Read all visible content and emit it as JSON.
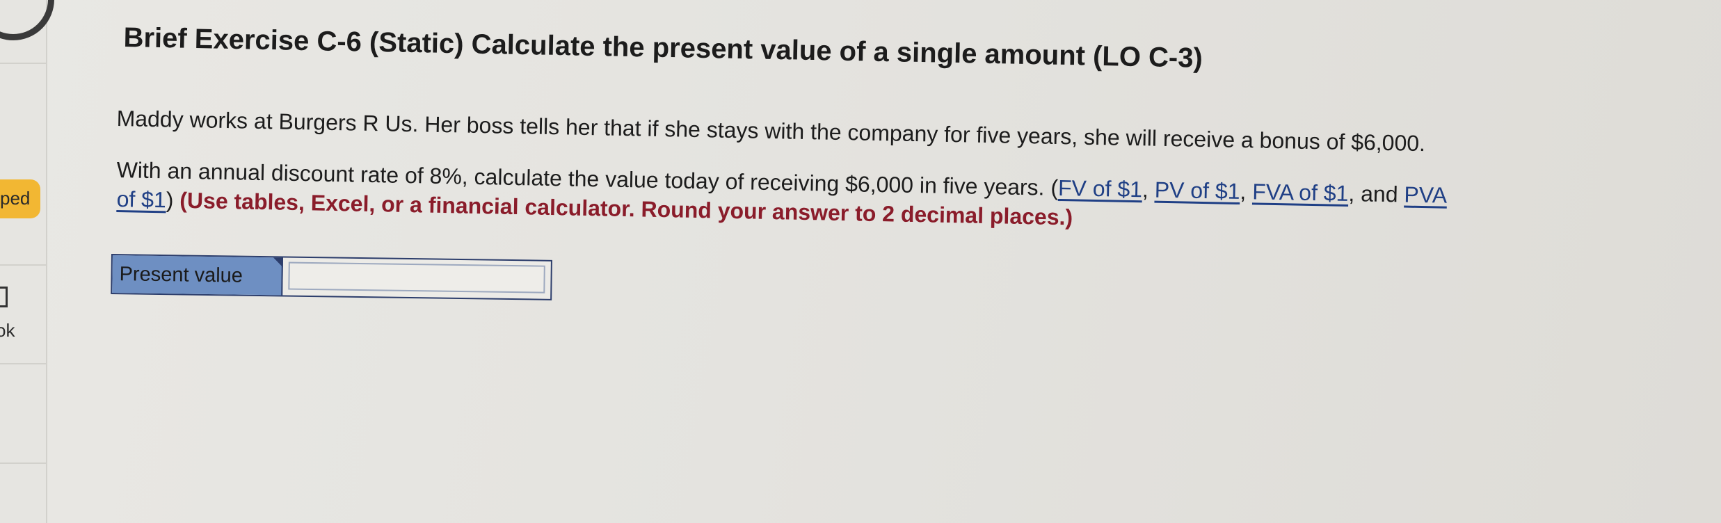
{
  "sidebar": {
    "badge_text": "ped",
    "book_text": "ok"
  },
  "problem": {
    "title": "Brief Exercise C-6 (Static) Calculate the present value of a single amount (LO C-3)",
    "line1": "Maddy works at Burgers R Us. Her boss tells her that if she stays with the company for five years, she will receive a bonus of $6,000.",
    "line2": "With an annual discount rate of 8%, calculate the value today of receiving $6,000 in five years. (",
    "links": {
      "fv": "FV of $1",
      "pv": "PV of $1",
      "fva": "FVA of $1",
      "pva": "PVA",
      "pva_cont": "of $1"
    },
    "sep1": ", ",
    "sep2": ", ",
    "sep3": ", and ",
    "close_paren": ") ",
    "instruction": "(Use tables, Excel, or a financial calculator. Round your answer to 2 decimal places.)"
  },
  "answer": {
    "label": "Present value",
    "value": ""
  },
  "colors": {
    "label_bg": "#6e8fc2",
    "link": "#1f3f85",
    "instruction": "#8a1c2a",
    "badge": "#f2b733"
  }
}
